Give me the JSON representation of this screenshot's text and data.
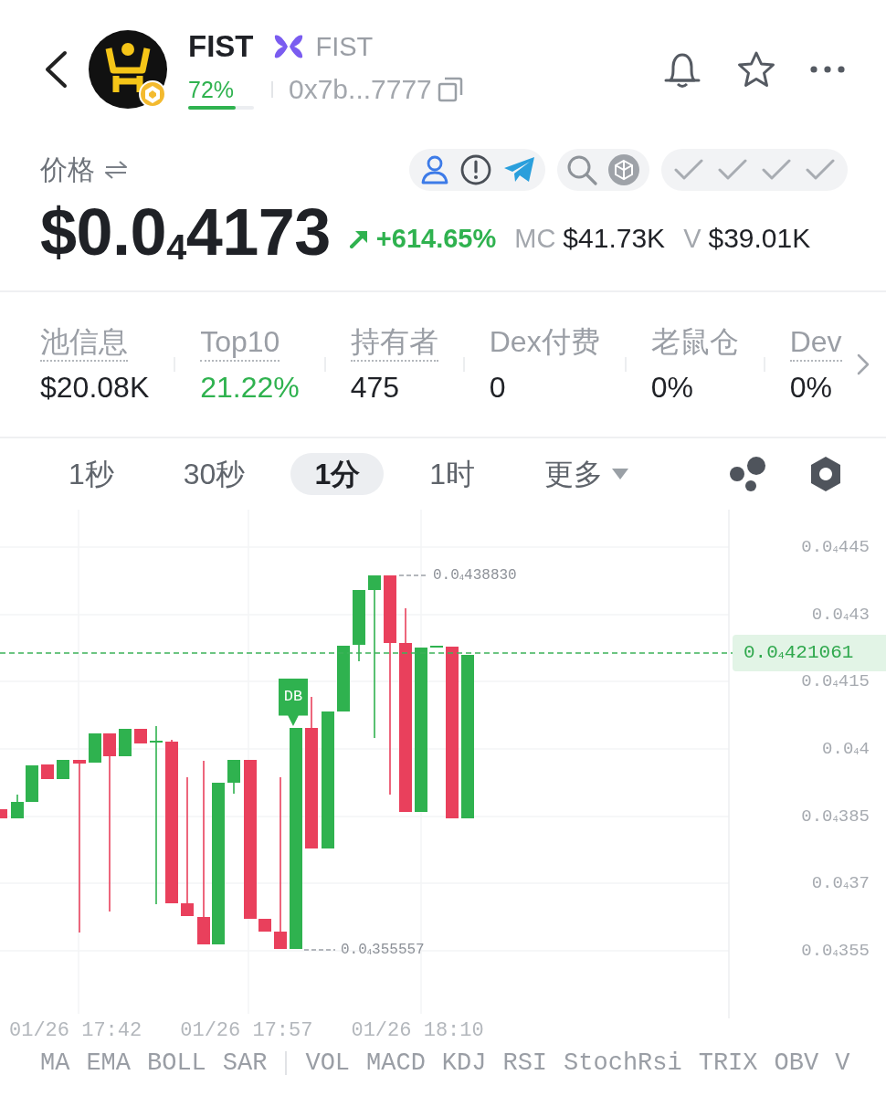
{
  "header": {
    "token_name": "FIST",
    "chain_name": "FIST",
    "progress": {
      "label": "72%",
      "level": 0.72
    },
    "address": "0x7b...7777"
  },
  "price": {
    "label": "价格",
    "value": "$0.0$_{4}$4173",
    "change": "+614.65%",
    "stats": [
      {
        "label": "MC",
        "value": "$41.73K"
      },
      {
        "label": "V",
        "value": "$39.01K"
      }
    ]
  },
  "metrics": [
    {
      "label": "池信息",
      "value": "$20.08K",
      "dotted": true,
      "positive": false
    },
    {
      "label": "Top10",
      "value": "21.22%",
      "dotted": true,
      "positive": true
    },
    {
      "label": "持有者",
      "value": "475",
      "dotted": true,
      "positive": false
    },
    {
      "label": "Dex付费",
      "value": "0",
      "dotted": false,
      "positive": false
    },
    {
      "label": "老鼠仓",
      "value": "0%",
      "dotted": false,
      "positive": false
    },
    {
      "label": "Dev",
      "value": "0%",
      "dotted": true,
      "positive": false
    }
  ],
  "timeframes": [
    {
      "label": "1秒",
      "selected": false
    },
    {
      "label": "30秒",
      "selected": false
    },
    {
      "label": "1分",
      "selected": true
    },
    {
      "label": "1时",
      "selected": false
    }
  ],
  "more_menu": {
    "label": "更多"
  },
  "chart": {
    "price_axis": [
      "0.0$_{4}$445",
      "0.0$_{4}$43",
      "0.0$_{4}$415",
      "0.0$_{4}$4",
      "0.0$_{4}$385",
      "0.0$_{4}$37",
      "0.0$_{4}$355"
    ],
    "current_price": "0.0$_{4}$421061",
    "high_label": "0.0$_{4}$438830",
    "low_label": "0.0$_{4}$355557",
    "signal": "DB",
    "time_axis": [
      "01/26 17:42",
      "01/26 17:57",
      "01/26 18:10"
    ]
  },
  "indicators": {
    "main": [
      "MA",
      "EMA",
      "BOLL",
      "SAR"
    ],
    "sub": [
      "VOL",
      "MACD",
      "KDJ",
      "RSI",
      "StochRsi",
      "TRIX",
      "OBV",
      "V"
    ]
  }
}
